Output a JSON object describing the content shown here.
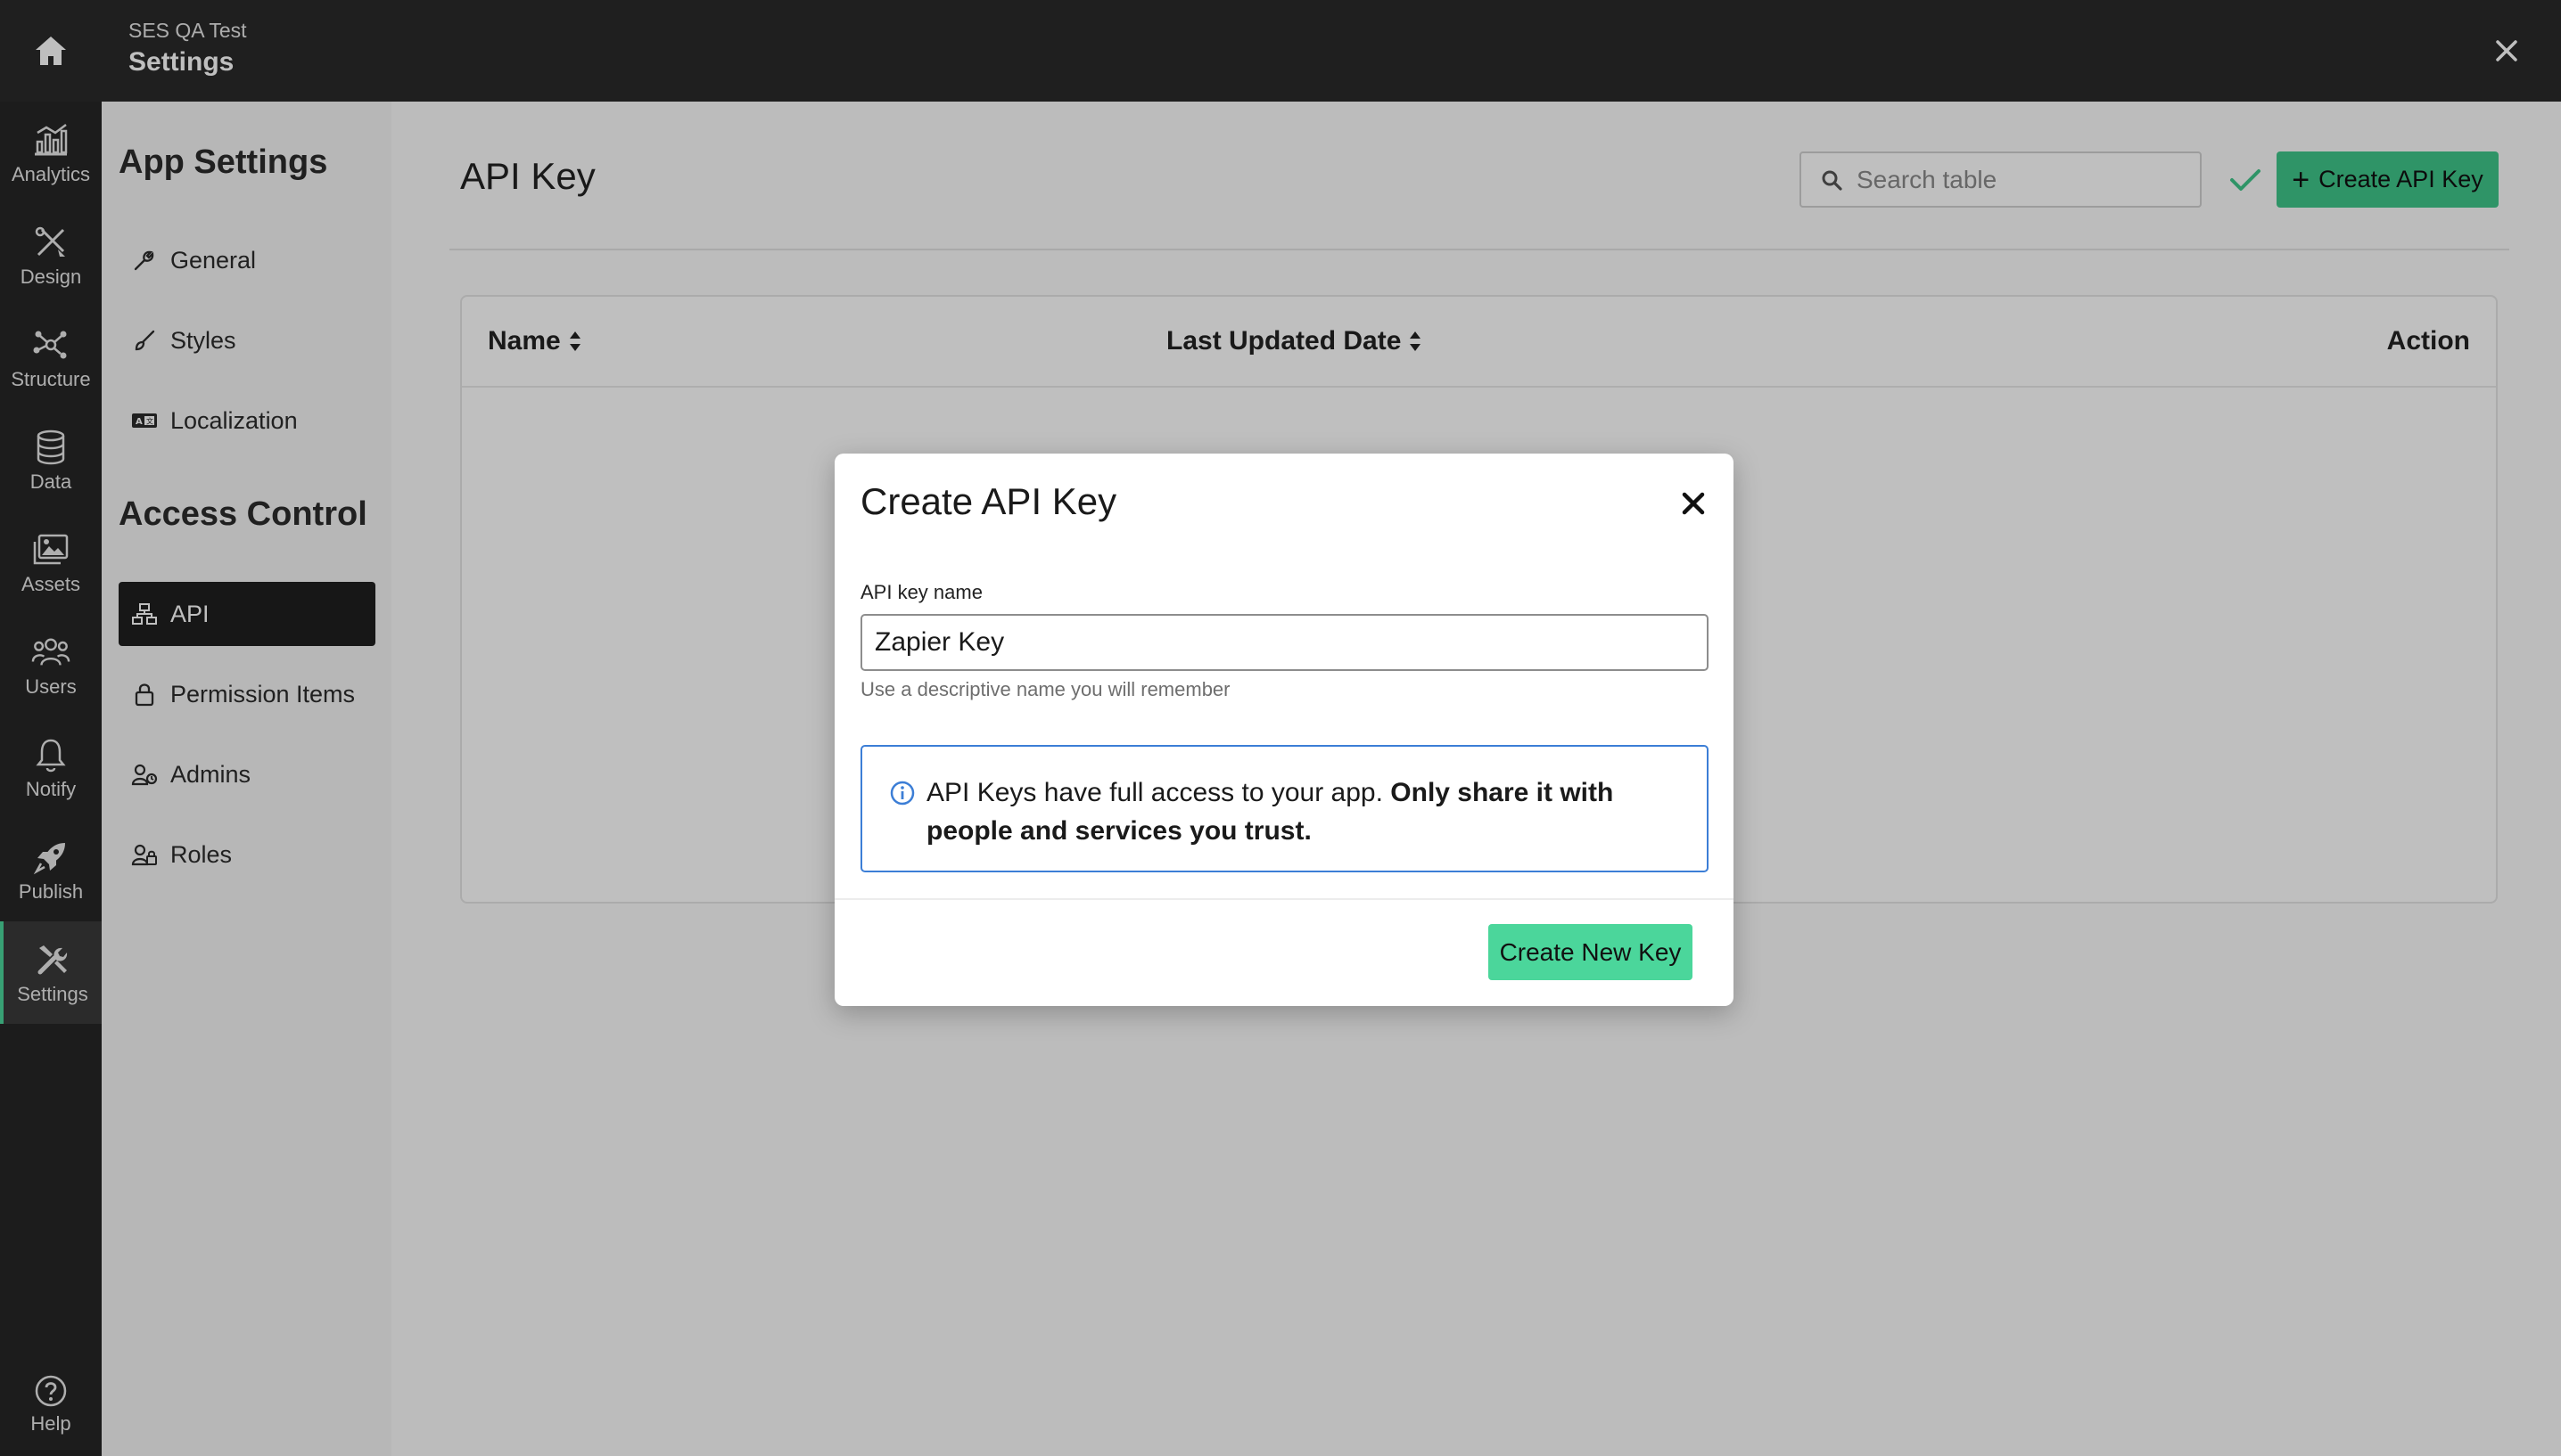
{
  "topbar": {
    "subtitle": "SES QA Test",
    "title": "Settings"
  },
  "leftnav": {
    "items": [
      {
        "label": "Analytics",
        "icon": "analytics-icon"
      },
      {
        "label": "Design",
        "icon": "design-icon"
      },
      {
        "label": "Structure",
        "icon": "structure-icon"
      },
      {
        "label": "Data",
        "icon": "database-icon"
      },
      {
        "label": "Assets",
        "icon": "images-icon"
      },
      {
        "label": "Users",
        "icon": "users-icon"
      },
      {
        "label": "Notify",
        "icon": "bell-icon"
      },
      {
        "label": "Publish",
        "icon": "rocket-icon"
      },
      {
        "label": "Settings",
        "icon": "tools-icon"
      }
    ],
    "active": "Settings",
    "help_label": "Help"
  },
  "sidepanel": {
    "app_settings_title": "App Settings",
    "app_settings_items": [
      {
        "label": "General",
        "icon": "wrench-icon"
      },
      {
        "label": "Styles",
        "icon": "brush-icon"
      },
      {
        "label": "Localization",
        "icon": "language-icon"
      }
    ],
    "access_control_title": "Access Control",
    "access_control_items": [
      {
        "label": "API",
        "icon": "network-icon"
      },
      {
        "label": "Permission Items",
        "icon": "lock-icon"
      },
      {
        "label": "Admins",
        "icon": "admin-icon"
      },
      {
        "label": "Roles",
        "icon": "role-icon"
      }
    ],
    "active": "API"
  },
  "main": {
    "page_title": "API Key",
    "search_placeholder": "Search table",
    "create_button": "Create API Key",
    "table": {
      "columns": [
        "Name",
        "Last Updated Date",
        "Action"
      ],
      "rows": []
    }
  },
  "modal": {
    "title": "Create API Key",
    "field_label": "API key name",
    "field_value": "Zapier Key",
    "field_help": "Use a descriptive name you will remember",
    "info_text": "API Keys have full access to your app.",
    "info_bold": "Only share it with people and services you trust.",
    "submit_label": "Create New Key"
  },
  "colors": {
    "accent": "#4bd69b",
    "info_border": "#3c7ed6",
    "topbar": "#2a2a2a"
  }
}
